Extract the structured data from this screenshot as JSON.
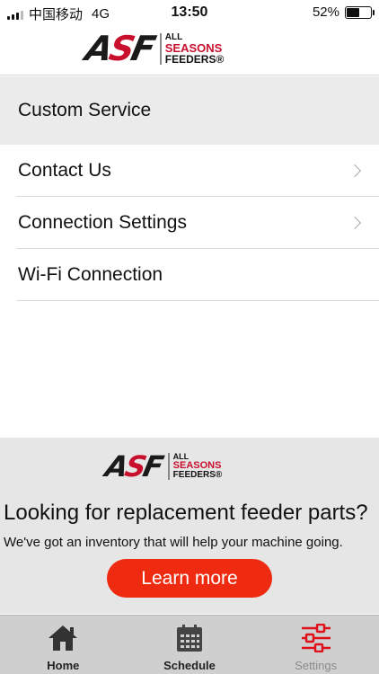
{
  "status_bar": {
    "carrier": "中国移动",
    "network": "4G",
    "time": "13:50",
    "battery_percent": "52%",
    "battery_level": 0.52
  },
  "brand": {
    "logo_mark": "ASF",
    "logo_line1": "ALL",
    "logo_line2": "SEASONS",
    "logo_line3": "FEEDERS®",
    "accent_color": "#c8102e"
  },
  "menu": {
    "section_header": "Custom Service",
    "items": [
      {
        "label": "Contact Us",
        "has_chevron": true
      },
      {
        "label": "Connection Settings",
        "has_chevron": true
      },
      {
        "label": "Wi-Fi Connection",
        "has_chevron": false
      }
    ]
  },
  "ad": {
    "title": "Looking for replacement feeder parts?",
    "subtitle": "We've got an inventory that will help your machine going.",
    "button_label": "Learn more",
    "button_color": "#ee2a10"
  },
  "tab_bar": {
    "tabs": [
      {
        "label": "Home",
        "icon": "home-icon",
        "active": false
      },
      {
        "label": "Schedule",
        "icon": "calendar-icon",
        "active": false
      },
      {
        "label": "Settings",
        "icon": "sliders-icon",
        "active": true
      }
    ],
    "active_color": "#e0101a"
  }
}
